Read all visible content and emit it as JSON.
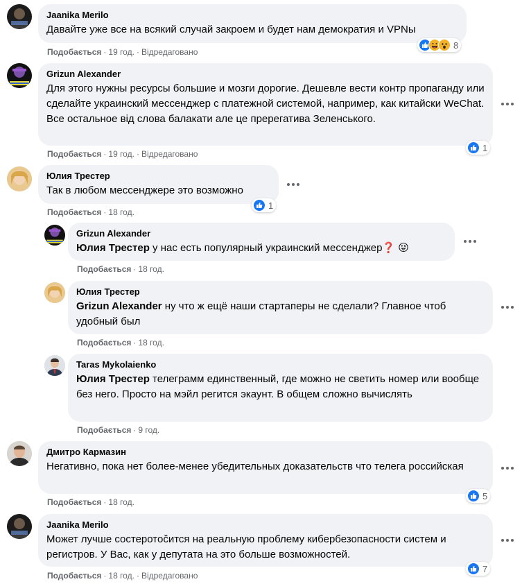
{
  "comments": [
    {
      "author": "Jaanika Merilo",
      "text": "Давайте уже все на всякий случай закроем и будет нам демократия и VPNы",
      "like_label": "Подобається",
      "time": "19 год.",
      "edited": "Відредаговано",
      "reaction_count": "8",
      "reaction_icons": [
        "like-icon",
        "haha-icon",
        "wow-icon"
      ]
    },
    {
      "author": "Grizun Alexander",
      "text": "Для этого нужны ресурсы большие и мозги дорогие. Дешевле вести контр пропаганду или сделайте украинский мессенджер с платежной системой, например, как китайски WeChat. Все остальное від слова балакати але це пререгатива Зеленського.",
      "like_label": "Подобається",
      "time": "19 год.",
      "edited": "Відредаговано",
      "reaction_count": "1"
    },
    {
      "author": "Юлия Трестер",
      "text": "Так в любом мессенджере это возможно",
      "like_label": "Подобається",
      "time": "18 год.",
      "reaction_count": "1"
    },
    {
      "author": "Grizun Alexander",
      "mention": "Юлия Трестер",
      "text": " у нас есть популярный украинский мессенджер❓ 😜",
      "like_label": "Подобається",
      "time": "18 год."
    },
    {
      "author": "Юлия Трестер",
      "mention": "Grizun Alexander",
      "text": " ну что ж ещё наши стартаперы не сделали? Главное чтоб удобный был",
      "like_label": "Подобається",
      "time": "18 год."
    },
    {
      "author": "Taras Mykolaienko",
      "mention": "Юлия Трестер",
      "text": " телеграмм единственный, где можно не светить номер или вообще без него. Просто на мэйл регится экаунт. В общем сложно вычислять",
      "like_label": "Подобається",
      "time": "9 год."
    },
    {
      "author": "Дмитро Кармазин",
      "text": "Негативно, пока нет более-менее убедительных доказательств что телега российская",
      "like_label": "Подобається",
      "time": "18 год.",
      "reaction_count": "5"
    },
    {
      "author": "Jaanika Merilo",
      "text": "Может лучше состеротоčится на реальную проблему кибербезопасности систем и регистров. У Вас, как у депутата на это больше возможностей.",
      "like_label": "Подобається",
      "time": "18 год.",
      "edited": "Відредаговано",
      "reaction_count": "7"
    }
  ],
  "separator": "·",
  "colors": {
    "bubble": "#f0f2f5",
    "meta": "#65676b",
    "like_blue": "#1877f2",
    "haha_yellow": "#f7b125"
  }
}
